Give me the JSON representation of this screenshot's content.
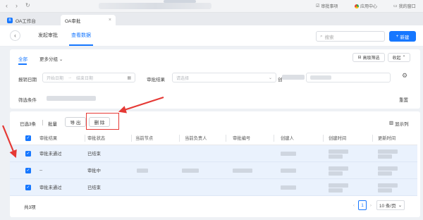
{
  "browser": {
    "right_items": [
      "审批事项",
      "应用中心",
      "我的窗口"
    ]
  },
  "tabs": [
    {
      "label": "OA工作台",
      "logo": "B"
    },
    {
      "label": "OA审批"
    }
  ],
  "header": {
    "nav": [
      "发起审批",
      "查看数据"
    ],
    "search_placeholder": "搜索",
    "new_button": "新建"
  },
  "filter": {
    "tabs": [
      "全部",
      "更多分组"
    ],
    "advanced_filter": "高级筛选",
    "collapse": "收起",
    "date_label": "报销日期",
    "start_date_placeholder": "开始日期",
    "end_date_placeholder": "结束日期",
    "result_label": "审批结果",
    "result_placeholder": "请选择",
    "partial_label": "创",
    "conditions_label": "筛选条件",
    "reset": "重置"
  },
  "toolbar": {
    "selected": "已选3条",
    "batch": "批量",
    "export": "导 出",
    "delete": "删 除",
    "show_columns": "显示列"
  },
  "table": {
    "columns": [
      "审批结果",
      "审批状态",
      "当前节点",
      "当前负责人",
      "审批编号",
      "创建人",
      "创建时间",
      "更新时间"
    ],
    "rows": [
      {
        "result": "审批未通过",
        "status": "已结束"
      },
      {
        "result": "--",
        "status": "审批中"
      },
      {
        "result": "审批未通过",
        "status": "已结束"
      }
    ]
  },
  "footer": {
    "total": "共3项",
    "current_page": "1",
    "page_size": "10 条/页"
  },
  "colors": {
    "accent": "#1677ff",
    "row_selected": "#eaf2fd",
    "annotation_red": "#e53935"
  }
}
